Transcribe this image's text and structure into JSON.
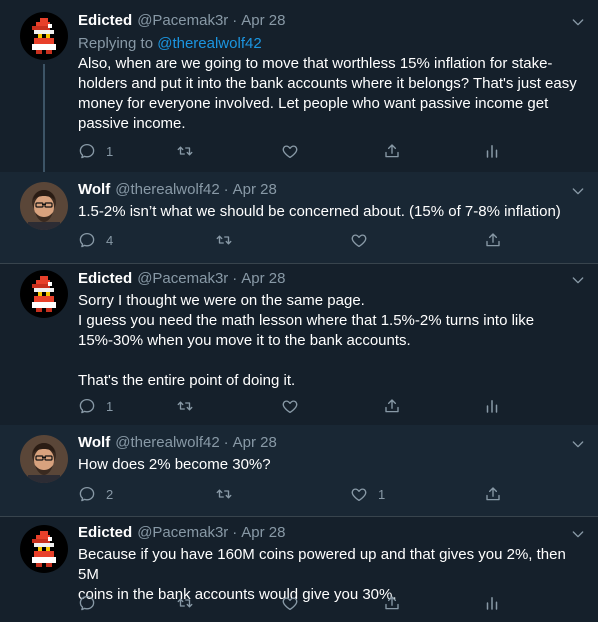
{
  "tweets": [
    {
      "name": "Edicted",
      "handle": "@Pacemak3r",
      "date": "Apr 28",
      "reply_prefix": "Replying to ",
      "reply_to": "@therealwolf42",
      "lines": [
        "Also, when are we going to move that worthless 15% inflation for stake-",
        "holders and put it into the bank accounts where it belongs?   That's just easy",
        "money for everyone involved.  Let people who want passive income get",
        "passive income."
      ],
      "reply_count": "1",
      "retweet_count": "",
      "like_count": ""
    },
    {
      "name": "Wolf",
      "handle": "@therealwolf42",
      "date": "Apr 28",
      "lines": [
        "1.5-2% isn’t what we should be concerned about. (15% of 7-8% inflation)"
      ],
      "reply_count": "4",
      "retweet_count": "",
      "like_count": ""
    },
    {
      "name": "Edicted",
      "handle": "@Pacemak3r",
      "date": "Apr 28",
      "lines": [
        "Sorry I thought we were on the same page.",
        "I guess you need the math lesson where that 1.5%-2% turns into like",
        "15%-30% when you move it to the bank accounts.",
        "",
        "That's the entire point of doing it."
      ],
      "reply_count": "1",
      "retweet_count": "",
      "like_count": ""
    },
    {
      "name": "Wolf",
      "handle": "@therealwolf42",
      "date": "Apr 28",
      "lines": [
        "How does 2% become 30%?"
      ],
      "reply_count": "2",
      "retweet_count": "",
      "like_count": "1"
    },
    {
      "name": "Edicted",
      "handle": "@Pacemak3r",
      "date": "Apr 28",
      "lines": [
        "Because if you have 160M coins powered up and that gives you 2%, then 5M",
        "coins in the bank accounts would give you 30%."
      ],
      "reply_count": "",
      "retweet_count": "",
      "like_count": ""
    }
  ],
  "icons": {
    "reply": "reply-icon",
    "retweet": "retweet-icon",
    "like": "heart-icon",
    "share": "share-icon",
    "analytics": "analytics-icon",
    "more": "chevron-down-icon"
  },
  "colors": {
    "background": "#15202b",
    "background_alt": "#192734",
    "text": "#ffffff",
    "muted": "#8899a6",
    "link": "#1b95e0",
    "separator": "#38444d"
  }
}
